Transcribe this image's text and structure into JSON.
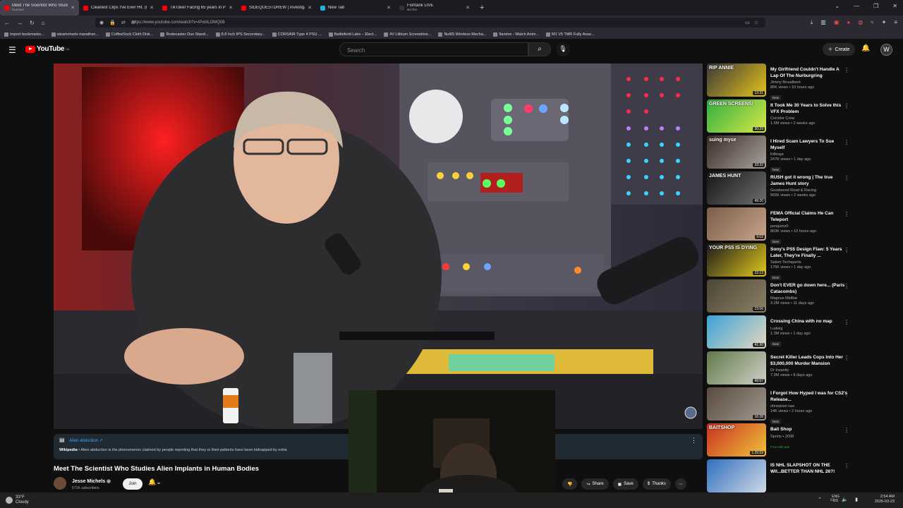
{
  "browser": {
    "tabs": [
      {
        "title": "Meet The Scientist Who Studies",
        "sub": "PLAYING",
        "color": "#f00",
        "active": true
      },
      {
        "title": "Cleanest Clips I've Ever Hit. (R",
        "sub": "",
        "color": "#f00",
        "active": false
      },
      {
        "title": "TikToker Facing 65 years in Pris",
        "sub": "",
        "color": "#f00",
        "active": false
      },
      {
        "title": "SIDEQUESTDREW | investigate",
        "sub": "",
        "color": "#f00",
        "active": false
      },
      {
        "title": "New Tab",
        "sub": "",
        "color": "#1fb5d6",
        "active": false
      },
      {
        "title": "Fishtank LIVE",
        "sub": "MUTED",
        "color": "#333",
        "active": false
      }
    ],
    "new_tab": "+",
    "url": "https://www.youtube.com/watch?v=iPxbILOMQ08",
    "bookmarks": [
      "Import bookmarks...",
      "steamcharts marathon...",
      "CoffeeSock Cloth Disk...",
      "Rodecaster Duo Stand...",
      "8.8 Inch IPS Secondary...",
      "CORSAIR Type 4 PSU ...",
      "Battlefield Labs – Elect...",
      "4V Lithium Screwdrive...",
      "Nut65 Wireless Mecha...",
      "9anime - Watch Anim...",
      "M1 V5 TMR Fully Asse..."
    ]
  },
  "header": {
    "logo": "YouTube",
    "region": "CA",
    "search_placeholder": "Search",
    "create_label": "Create"
  },
  "wiki": {
    "title": "Alien abduction ↗",
    "source": "Wikipedia",
    "text": " • Alien abduction is the phenomenon claimed by people reporting that they or their patients have been kidnapped by extra"
  },
  "video": {
    "title": "Meet The Scientist Who Studies Alien Implants in Human Bodies",
    "channel": "Jesse Michels",
    "subscribers": "571K subscribers",
    "join": "Join",
    "share": "Share",
    "save": "Save",
    "thanks": "Thanks"
  },
  "recommendations": [
    {
      "title": "My Girlfriend Couldn't Handle A Lap Of The Nurburgring",
      "channel": "Jimmy Broadbent",
      "views": "86K views • 10 hours ago",
      "badge": "New",
      "duration": "13:31",
      "colors": [
        "#3a3a3a",
        "#e5c21a"
      ],
      "caption": "RIP ANNIE"
    },
    {
      "title": "It Took Me 30 Years to Solve this VFX Problem",
      "channel": "Corridor Crew",
      "views": "1.5M views • 2 weeks ago",
      "badge": "",
      "duration": "30:29",
      "colors": [
        "#2fae3f",
        "#d7e84a"
      ],
      "caption": "GREEN SCREENS!"
    },
    {
      "title": "I Hired Scam Lawyers To Sue Myself",
      "channel": "Kitboga",
      "views": "247K views • 1 day ago",
      "badge": "New",
      "duration": "33:32",
      "colors": [
        "#3b2a25",
        "#a8a29e"
      ],
      "caption": "suing myse"
    },
    {
      "title": "RUSH got it wrong | The true James Hunt story",
      "channel": "Goodwood Road & Racing",
      "views": "565K views • 2 weeks ago",
      "badge": "",
      "duration": "49:20",
      "colors": [
        "#161616",
        "#6d6d6d"
      ],
      "caption": "JAMES HUNT"
    },
    {
      "title": "FEMA Official Claims He Can Teleport",
      "channel": "penguinz0",
      "views": "803K views • 10 hours ago",
      "badge": "New",
      "duration": "9:02",
      "colors": [
        "#7a5d4a",
        "#c9a58a"
      ],
      "caption": ""
    },
    {
      "title": "Sony's PS5 Design Flaw: 5 Years Later, They're Finally ...",
      "channel": "Salem Techsperts",
      "views": "176K views • 1 day ago",
      "badge": "New",
      "duration": "22:13",
      "colors": [
        "#1b1b1b",
        "#e3c81d"
      ],
      "caption": "YOUR PS5 IS DYING"
    },
    {
      "title": "Don't EVER go down here... (Paris Catacombs)",
      "channel": "Magnus Midtbø",
      "views": "3.2M views • 11 days ago",
      "badge": "",
      "duration": "23:06",
      "colors": [
        "#4c4536",
        "#8d8166"
      ],
      "caption": ""
    },
    {
      "title": "Crossing China with no map",
      "channel": "Ludwig",
      "views": "1.3M views • 1 day ago",
      "badge": "New",
      "duration": "41:30",
      "colors": [
        "#3aa2d8",
        "#e6d9c0"
      ],
      "caption": ""
    },
    {
      "title": "Secret Killer Leads Cops Into Her $3,000,000 Murder Mansion",
      "channel": "Dr Insanity",
      "views": "7.9M views • 8 days ago",
      "badge": "",
      "duration": "49:57",
      "colors": [
        "#5f7a4a",
        "#cfcfc6"
      ],
      "caption": ""
    },
    {
      "title": "I Forgot How Hyped I was for CS2's Release...",
      "channel": "ohnepixel raw",
      "views": "14K views • 2 hours ago",
      "badge": "New",
      "duration": "16:28",
      "colors": [
        "#5a4a3e",
        "#a0988e"
      ],
      "caption": ""
    },
    {
      "title": "Bait Shop",
      "channel": "Sports • 2008",
      "views": "",
      "badge": "Free with ads",
      "duration": "1:25:59",
      "colors": [
        "#c63222",
        "#f2c13a"
      ],
      "caption": "BAITSHOP"
    },
    {
      "title": "IS NHL SLAPSHOT ON THE WII...BETTER THAN NHL 26?!",
      "channel": "",
      "views": "",
      "badge": "",
      "duration": "",
      "colors": [
        "#2f6fbf",
        "#cfd9e6"
      ],
      "caption": ""
    }
  ],
  "taskbar": {
    "temp": "33°F",
    "condition": "Cloudy",
    "lang1": "ENG",
    "lang2": "US",
    "time": "2:54 AM",
    "date": "2026-03-23"
  }
}
